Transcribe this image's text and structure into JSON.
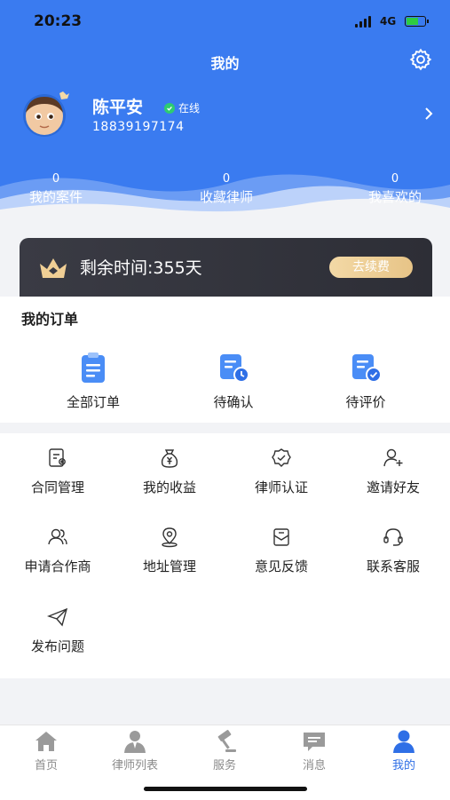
{
  "status_bar": {
    "time": "20:23",
    "network": "4G"
  },
  "header": {
    "title": "我的"
  },
  "profile": {
    "name": "陈平安",
    "status": "在线",
    "phone": "18839197174"
  },
  "stats": [
    {
      "value": "0",
      "label": "我的案件"
    },
    {
      "value": "0",
      "label": "收藏律师"
    },
    {
      "value": "0",
      "label": "我喜欢的"
    }
  ],
  "vip": {
    "text": "剩余时间:355天",
    "renew_label": "去续费"
  },
  "orders": {
    "title": "我的订单",
    "items": [
      {
        "label": "全部订单",
        "icon": "clipboard-icon"
      },
      {
        "label": "待确认",
        "icon": "document-clock-icon"
      },
      {
        "label": "待评价",
        "icon": "document-check-icon"
      }
    ]
  },
  "tools": [
    {
      "label": "合同管理",
      "icon": "contract-icon"
    },
    {
      "label": "我的收益",
      "icon": "money-bag-icon"
    },
    {
      "label": "律师认证",
      "icon": "badge-check-icon"
    },
    {
      "label": "邀请好友",
      "icon": "user-add-icon"
    },
    {
      "label": "申请合作商",
      "icon": "users-icon"
    },
    {
      "label": "地址管理",
      "icon": "location-pin-icon"
    },
    {
      "label": "意见反馈",
      "icon": "feedback-icon"
    },
    {
      "label": "联系客服",
      "icon": "headset-icon"
    },
    {
      "label": "发布问题",
      "icon": "send-icon"
    }
  ],
  "tabbar": [
    {
      "label": "首页",
      "icon": "home-icon"
    },
    {
      "label": "律师列表",
      "icon": "lawyer-icon"
    },
    {
      "label": "服务",
      "icon": "gavel-icon"
    },
    {
      "label": "消息",
      "icon": "message-icon"
    },
    {
      "label": "我的",
      "icon": "person-icon",
      "active": true
    }
  ],
  "colors": {
    "primary": "#3a7bf0",
    "active_tab": "#2f6fe6",
    "vip_bg": "#2d2e36",
    "renew": "#e7c487"
  }
}
